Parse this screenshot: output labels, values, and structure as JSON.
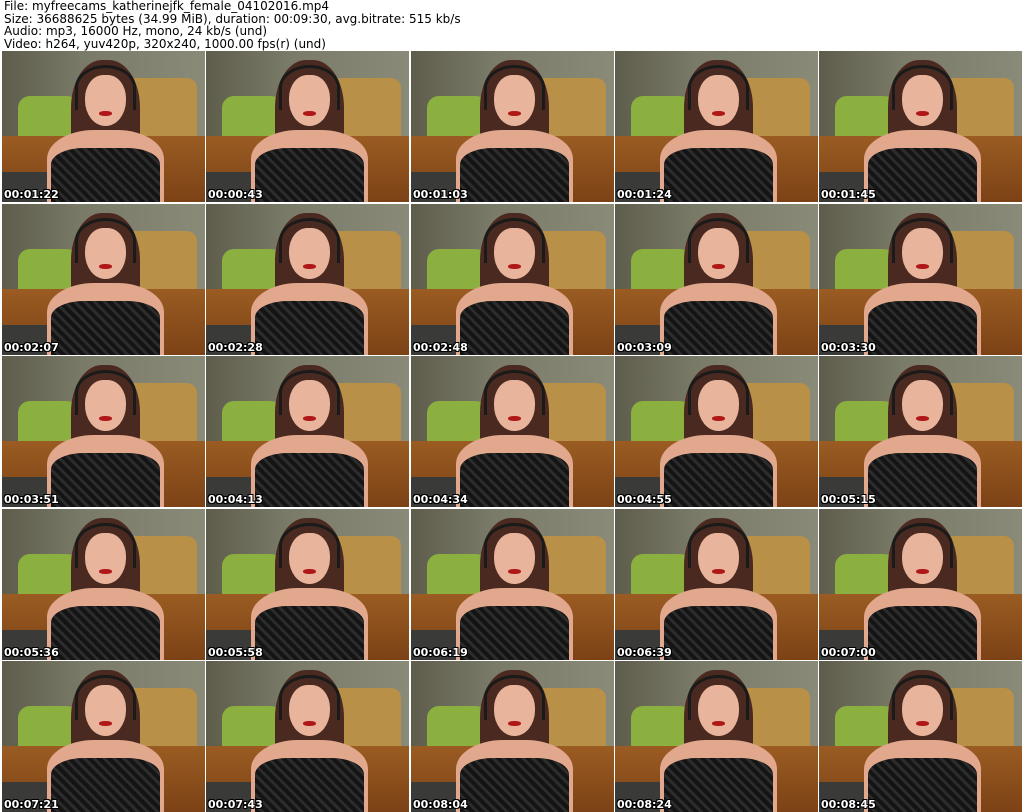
{
  "info": {
    "file": "File: myfreecams_katherinejfk_female_04102016.mp4",
    "size": "Size: 36688625 bytes (34.99 MiB), duration: 00:09:30, avg.bitrate: 515 kb/s",
    "audio": "Audio: mp3, 16000 Hz, mono, 24 kb/s (und)",
    "video": "Video: h264, yuv420p, 320x240, 1000.00 fps(r) (und)"
  },
  "thumbnails": [
    "00:01:22",
    "00:00:43",
    "00:01:03",
    "00:01:24",
    "00:01:45",
    "00:02:07",
    "00:02:28",
    "00:02:48",
    "00:03:09",
    "00:03:30",
    "00:03:51",
    "00:04:13",
    "00:04:34",
    "00:04:55",
    "00:05:15",
    "00:05:36",
    "00:05:58",
    "00:06:19",
    "00:06:39",
    "00:07:00",
    "00:07:21",
    "00:07:43",
    "00:08:04",
    "00:08:24",
    "00:08:45"
  ]
}
